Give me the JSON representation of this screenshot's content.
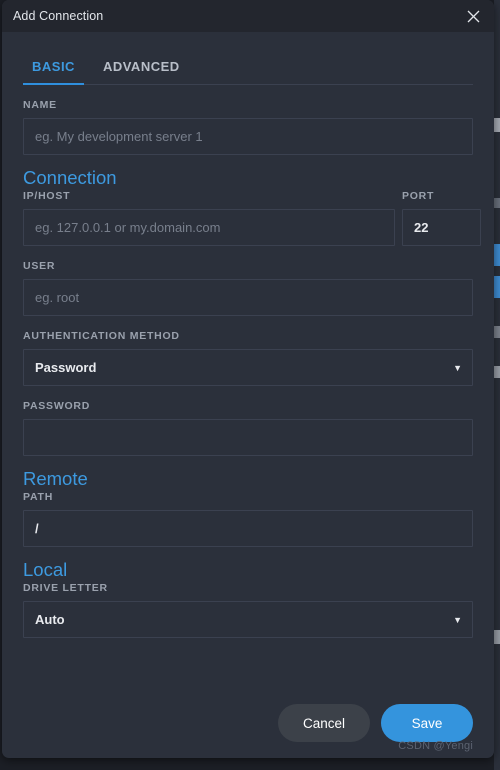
{
  "window": {
    "title": "Add Connection",
    "close_icon": "close-icon"
  },
  "tabs": [
    {
      "label": "BASIC",
      "active": true
    },
    {
      "label": "ADVANCED",
      "active": false
    }
  ],
  "fields": {
    "name": {
      "label": "NAME",
      "placeholder": "eg. My development server 1",
      "value": ""
    },
    "host": {
      "label": "IP/HOST",
      "placeholder": "eg. 127.0.0.1 or my.domain.com",
      "value": ""
    },
    "port": {
      "label": "PORT",
      "placeholder": "",
      "value": "22"
    },
    "user": {
      "label": "USER",
      "placeholder": "eg. root",
      "value": ""
    },
    "auth_method": {
      "label": "AUTHENTICATION METHOD",
      "value": "Password",
      "options": [
        "Password"
      ]
    },
    "password": {
      "label": "PASSWORD",
      "placeholder": "",
      "value": ""
    },
    "path": {
      "label": "PATH",
      "placeholder": "",
      "value": "/"
    },
    "drive_letter": {
      "label": "DRIVE LETTER",
      "value": "Auto",
      "options": [
        "Auto"
      ]
    }
  },
  "sections": {
    "connection": "Connection",
    "remote": "Remote",
    "local": "Local"
  },
  "footer": {
    "cancel_label": "Cancel",
    "save_label": "Save"
  },
  "watermark": "CSDN @Yengi",
  "colors": {
    "accent": "#3d9ae0",
    "save_button": "#3494dd",
    "dialog_bg": "#2b303b",
    "titlebar_bg": "#23262e",
    "border": "#3b4150"
  }
}
